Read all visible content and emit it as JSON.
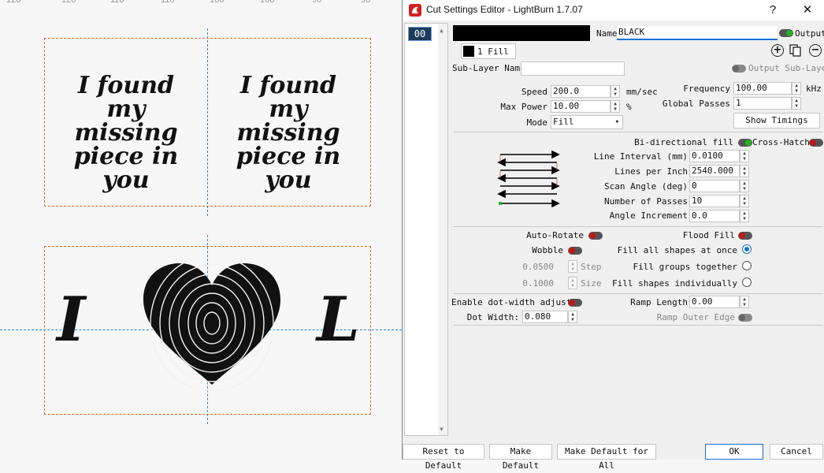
{
  "canvas": {
    "ruler": [
      "120",
      "120",
      "110",
      "110",
      "100",
      "100",
      "90",
      "90"
    ],
    "card1": {
      "lines": [
        "I found",
        "my",
        "missing",
        "piece in you"
      ]
    },
    "card2": {
      "lines": [
        "I found",
        "my",
        "missing",
        "piece in you"
      ]
    },
    "card3": {
      "left_letter": "I",
      "right_letter": "L"
    }
  },
  "dialog": {
    "title": "Cut Settings Editor - LightBurn 1.7.07",
    "help": "?",
    "close": "✕",
    "layer_index": "00",
    "layer_color": "#000000",
    "name_label": "Name",
    "name_value": "BLACK",
    "output_label": "Output",
    "sublayer_tab": "1 Fill",
    "sublayer_name_label": "Sub-Layer Name",
    "sublayer_name_value": "",
    "output_sublayer_label": "Output Sub-Layer",
    "speed_label": "Speed",
    "speed_value": "200.0",
    "speed_unit": "mm/sec",
    "max_power_label": "Max Power",
    "max_power_value": "10.00",
    "max_power_unit": "%",
    "mode_label": "Mode",
    "mode_value": "Fill",
    "frequency_label": "Frequency",
    "frequency_value": "100.00",
    "frequency_unit": "kHz",
    "global_passes_label": "Global Passes",
    "global_passes_value": "1",
    "show_timings": "Show Timings",
    "bidir_label": "Bi-directional fill",
    "crosshatch_label": "Cross-Hatch",
    "line_interval_label": "Line Interval (mm)",
    "line_interval_value": "0.0100",
    "lines_per_inch_label": "Lines per Inch",
    "lines_per_inch_value": "2540.000",
    "scan_angle_label": "Scan Angle (deg)",
    "scan_angle_value": "0",
    "num_passes_label": "Number of Passes",
    "num_passes_value": "10",
    "angle_increment_label": "Angle Increment",
    "angle_increment_value": "0.0",
    "auto_rotate_label": "Auto-Rotate",
    "flood_fill_label": "Flood Fill",
    "wobble_label": "Wobble",
    "step_value": "0.0500",
    "step_label": "Step",
    "size_value": "0.1000",
    "size_label": "Size",
    "fill_all_label": "Fill all shapes at once",
    "fill_groups_label": "Fill groups together",
    "fill_individual_label": "Fill shapes individually",
    "dot_width_adjust_label": "Enable dot-width adjust",
    "dot_width_label": "Dot Width:",
    "dot_width_value": "0.080",
    "ramp_length_label": "Ramp Length",
    "ramp_length_value": "0.00",
    "ramp_outer_label": "Ramp Outer Edge",
    "reset_default": "Reset to Default",
    "make_default": "Make Default",
    "make_default_all": "Make Default for All",
    "ok": "OK",
    "cancel": "Cancel"
  }
}
